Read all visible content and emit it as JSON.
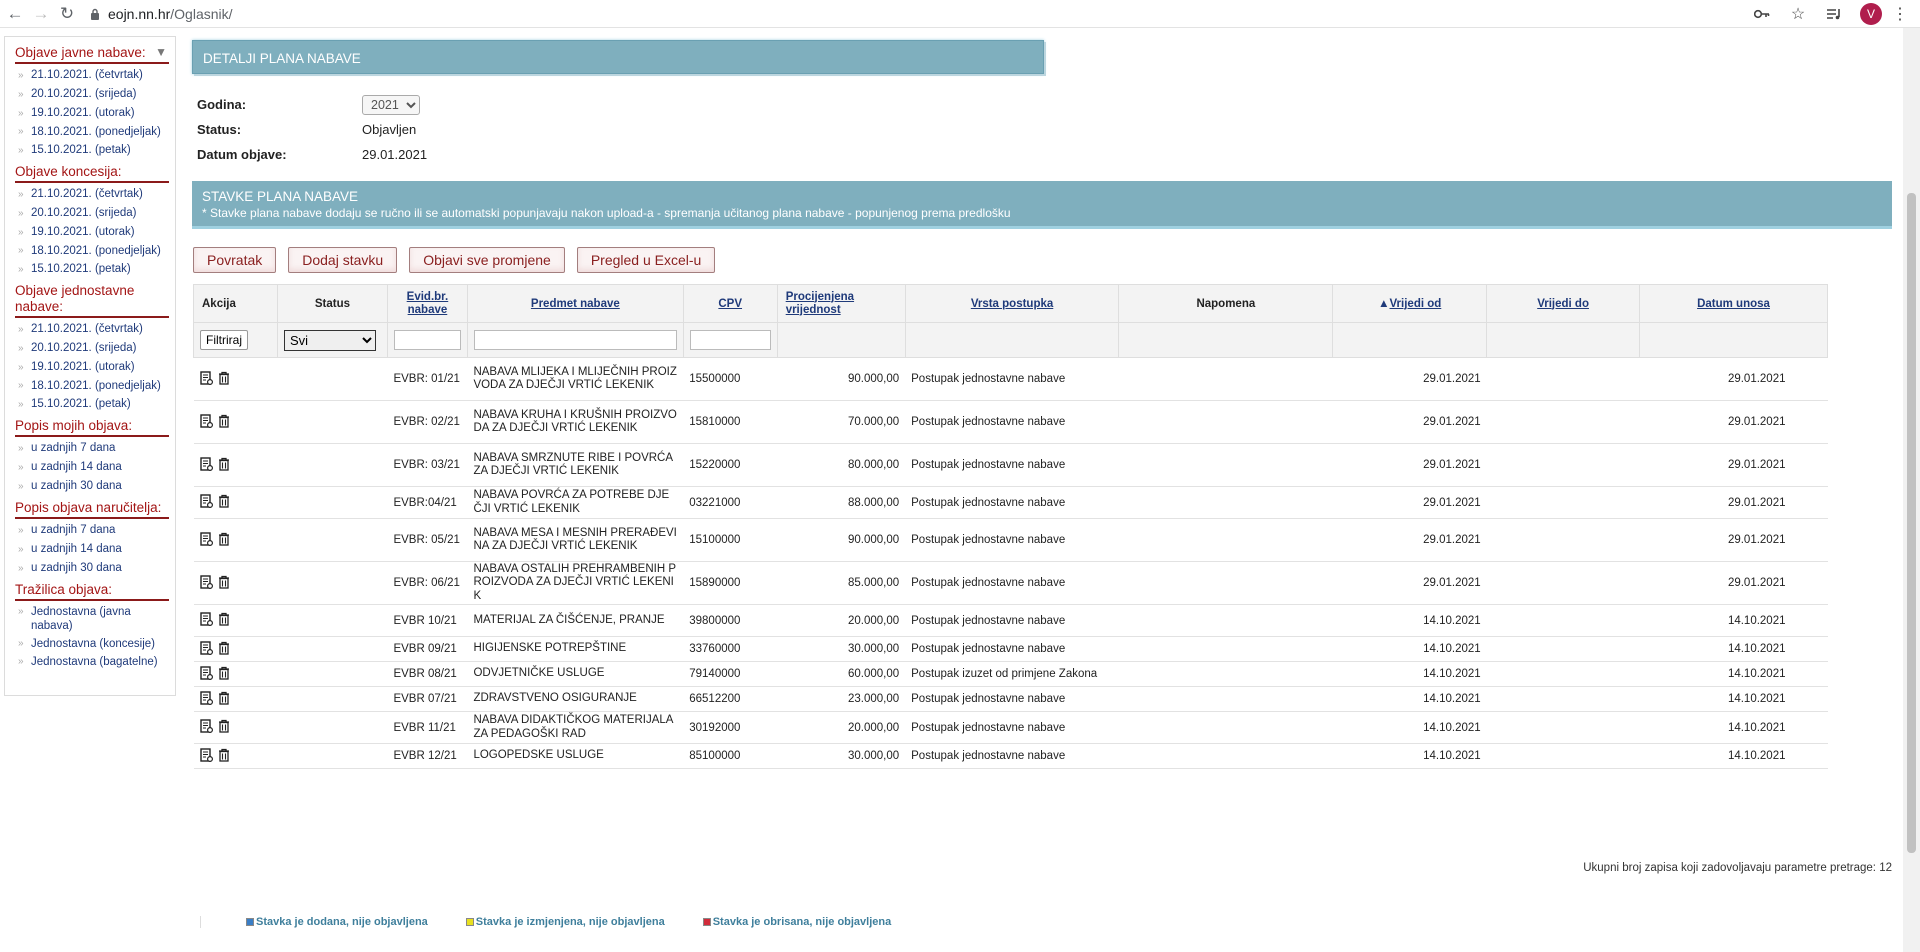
{
  "browser": {
    "url_host": "eojn.nn.hr",
    "url_path": "/Oglasnik/",
    "avatar_letter": "V"
  },
  "sidebar": {
    "sections": [
      {
        "title": "Objave javne nabave:",
        "items": [
          "21.10.2021. (četvrtak)",
          "20.10.2021. (srijeda)",
          "19.10.2021. (utorak)",
          "18.10.2021. (ponedjeljak)",
          "15.10.2021. (petak)"
        ]
      },
      {
        "title": "Objave koncesija:",
        "items": [
          "21.10.2021. (četvrtak)",
          "20.10.2021. (srijeda)",
          "19.10.2021. (utorak)",
          "18.10.2021. (ponedjeljak)",
          "15.10.2021. (petak)"
        ]
      },
      {
        "title": "Objave jednostavne nabave:",
        "items": [
          "21.10.2021. (četvrtak)",
          "20.10.2021. (srijeda)",
          "19.10.2021. (utorak)",
          "18.10.2021. (ponedjeljak)",
          "15.10.2021. (petak)"
        ]
      },
      {
        "title": "Popis mojih objava:",
        "items": [
          "u zadnjih 7 dana",
          "u zadnjih 14 dana",
          "u zadnjih 30 dana"
        ]
      },
      {
        "title": "Popis objava naručitelja:",
        "items": [
          "u zadnjih 7 dana",
          "u zadnjih 14 dana",
          "u zadnjih 30 dana"
        ]
      },
      {
        "title": "Tražilica objava:",
        "items": [
          "Jednostavna (javna nabava)",
          "Jednostavna (koncesije)",
          "Jednostavna (bagatelne)"
        ]
      }
    ]
  },
  "detalji": {
    "header": "DETALJI PLANA NABAVE",
    "godina_label": "Godina:",
    "godina_value": "2021",
    "status_label": "Status:",
    "status_value": "Objavljen",
    "datum_label": "Datum objave:",
    "datum_value": "29.01.2021"
  },
  "stavke": {
    "header": "STAVKE PLANA NABAVE",
    "note": "* Stavke plana nabave dodaju se ručno ili se automatski popunjavaju nakon upload-a - spremanja učitanog plana nabave - popunjenog prema predlošku"
  },
  "toolbar": {
    "povratak": "Povratak",
    "dodaj": "Dodaj stavku",
    "objavi": "Objavi sve promjene",
    "excel": "Pregled u Excel-u"
  },
  "table": {
    "headers": {
      "akcija": "Akcija",
      "status": "Status",
      "evid": "Evid.br. nabave",
      "predmet": "Predmet nabave",
      "cpv": "CPV",
      "vrijednost": "Procijenjena vrijednost",
      "vrsta": "Vrsta postupka",
      "napomena": "Napomena",
      "vrijedi_od": "Vrijedi od",
      "vrijedi_do": "Vrijedi do",
      "datum_unosa": "Datum unosa"
    },
    "filter_button": "Filtriraj",
    "status_filter": "Svi",
    "rows": [
      {
        "evid": "EVBR: 01/21",
        "predmet": "NABAVA MLIJEKA I MLIJEČNIH PROIZVODA ZA DJEČJI VRTIĆ LEKENIK",
        "cpv": "15500000",
        "vrijednost": "90.000,00",
        "vrsta": "Postupak jednostavne nabave",
        "od": "29.01.2021",
        "unos": "29.01.2021"
      },
      {
        "evid": "EVBR: 02/21",
        "predmet": "NABAVA KRUHA I KRUŠNIH PROIZVODA ZA DJEČJI VRTIĆ LEKENIK",
        "cpv": "15810000",
        "vrijednost": "70.000,00",
        "vrsta": "Postupak jednostavne nabave",
        "od": "29.01.2021",
        "unos": "29.01.2021"
      },
      {
        "evid": "EVBR: 03/21",
        "predmet": "NABAVA SMRZNUTE RIBE I POVRĆA ZA DJEČJI VRTIĆ LEKENIK",
        "cpv": "15220000",
        "vrijednost": "80.000,00",
        "vrsta": "Postupak jednostavne nabave",
        "od": "29.01.2021",
        "unos": "29.01.2021"
      },
      {
        "evid": "EVBR:04/21",
        "predmet": "NABAVA POVRĆA ZA POTREBE DJEČJI VRTIĆ LEKENIK",
        "cpv": "03221000",
        "vrijednost": "88.000,00",
        "vrsta": "Postupak jednostavne nabave",
        "od": "29.01.2021",
        "unos": "29.01.2021"
      },
      {
        "evid": "EVBR: 05/21",
        "predmet": "NABAVA MESA I MESNIH PRERAĐEVINA ZA DJEČJI VRTIĆ LEKENIK",
        "cpv": "15100000",
        "vrijednost": "90.000,00",
        "vrsta": "Postupak jednostavne nabave",
        "od": "29.01.2021",
        "unos": "29.01.2021"
      },
      {
        "evid": "EVBR: 06/21",
        "predmet": "NABAVA OSTALIH PREHRAMBENIH PROIZVODA ZA DJEČJI VRTIĆ LEKENIK",
        "cpv": "15890000",
        "vrijednost": "85.000,00",
        "vrsta": "Postupak jednostavne nabave",
        "od": "29.01.2021",
        "unos": "29.01.2021"
      },
      {
        "evid": "EVBR 10/21",
        "predmet": "MATERIJAL ZA ČIŠĆENJE, PRANJE",
        "cpv": "39800000",
        "vrijednost": "20.000,00",
        "vrsta": "Postupak jednostavne nabave",
        "od": "14.10.2021",
        "unos": "14.10.2021"
      },
      {
        "evid": "EVBR 09/21",
        "predmet": "HIGIJENSKE POTREPŠTINE",
        "cpv": "33760000",
        "vrijednost": "30.000,00",
        "vrsta": "Postupak jednostavne nabave",
        "od": "14.10.2021",
        "unos": "14.10.2021"
      },
      {
        "evid": "EVBR 08/21",
        "predmet": "ODVJETNIČKE USLUGE",
        "cpv": "79140000",
        "vrijednost": "60.000,00",
        "vrsta": "Postupak izuzet od primjene Zakona",
        "od": "14.10.2021",
        "unos": "14.10.2021"
      },
      {
        "evid": "EVBR 07/21",
        "predmet": "ZDRAVSTVENO OSIGURANJE",
        "cpv": "66512200",
        "vrijednost": "23.000,00",
        "vrsta": "Postupak jednostavne nabave",
        "od": "14.10.2021",
        "unos": "14.10.2021"
      },
      {
        "evid": "EVBR 11/21",
        "predmet": "NABAVA DIDAKTIČKOG MATERIJALA ZA PEDAGOŠKI RAD",
        "cpv": "30192000",
        "vrijednost": "20.000,00",
        "vrsta": "Postupak jednostavne nabave",
        "od": "14.10.2021",
        "unos": "14.10.2021"
      },
      {
        "evid": "EVBR 12/21",
        "predmet": "LOGOPEDSKE USLUGE",
        "cpv": "85100000",
        "vrijednost": "30.000,00",
        "vrsta": "Postupak jednostavne nabave",
        "od": "14.10.2021",
        "unos": "14.10.2021"
      }
    ],
    "total_text": "Ukupni broj zapisa koji zadovoljavaju parametre pretrage: 12"
  },
  "legend": {
    "items": [
      {
        "label": "Stavka je dodana, nije objavljena",
        "color": "#3a7ec6"
      },
      {
        "label": "Stavka je izmjenjena, nije objavljena",
        "color": "#e8e020"
      },
      {
        "label": "Stavka je obrisana, nije objavljena",
        "color": "#d12b3a"
      }
    ]
  }
}
